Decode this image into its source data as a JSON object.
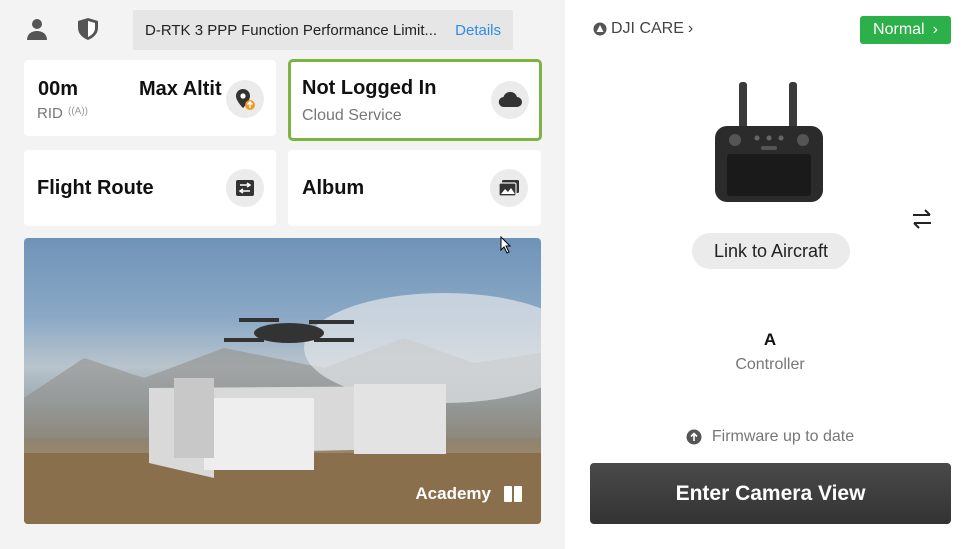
{
  "header": {
    "notice_text": "D-RTK 3 PPP Function Performance Limit...",
    "details_label": "Details"
  },
  "cards": {
    "altitude": {
      "value_left": "00m",
      "title": "Max Altit",
      "rid_label": "RID"
    },
    "cloud": {
      "title": "Not Logged In",
      "subtitle": "Cloud Service",
      "highlight_color": "#7cb342"
    },
    "flight_route": {
      "title": "Flight Route"
    },
    "album": {
      "title": "Album"
    }
  },
  "banner": {
    "label": "Academy"
  },
  "right_panel": {
    "dji_care_label": "DJI CARE",
    "status_label": "Normal",
    "status_color": "#2bb04a",
    "link_label": "Link to Aircraft",
    "controller_name": "A",
    "controller_label": "Controller",
    "firmware_text": "Firmware up to date",
    "enter_label": "Enter Camera View"
  }
}
